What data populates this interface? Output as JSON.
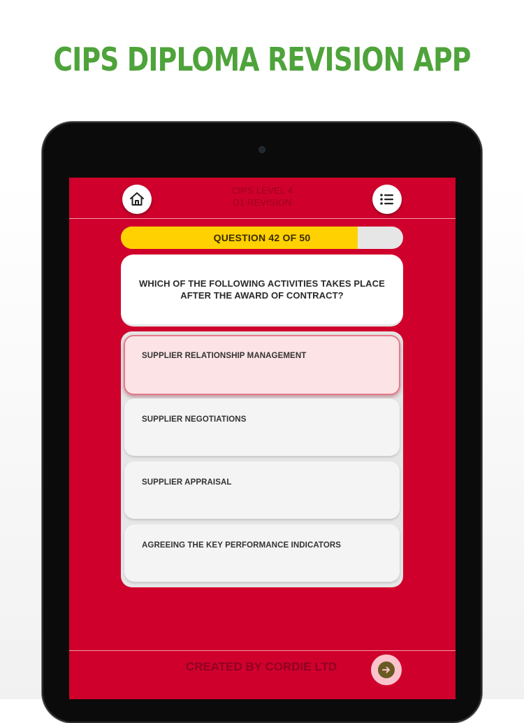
{
  "promo": {
    "title": "CIPS DIPLOMA REVISION APP"
  },
  "header": {
    "title_line1": "CIPS LEVEL 4",
    "title_line2": "D1 REVISION",
    "home_icon": "home-icon",
    "menu_icon": "list-menu-icon"
  },
  "progress": {
    "label": "QUESTION 42 OF 50",
    "current": 42,
    "total": 50,
    "fill_color": "#ffd100"
  },
  "question": {
    "text": "WHICH OF THE FOLLOWING ACTIVITIES TAKES PLACE AFTER THE AWARD OF CONTRACT?"
  },
  "answers": [
    {
      "label": "SUPPLIER RELATIONSHIP MANAGEMENT",
      "selected": true
    },
    {
      "label": "SUPPLIER NEGOTIATIONS",
      "selected": false
    },
    {
      "label": "SUPPLIER APPRAISAL",
      "selected": false
    },
    {
      "label": "AGREEING THE KEY PERFORMANCE INDICATORS",
      "selected": false
    }
  ],
  "footer": {
    "text": "CREATED BY CORDIE LTD",
    "next_icon": "arrow-right-icon"
  },
  "colors": {
    "brand_green": "#4ea33a",
    "screen_red": "#d0002c",
    "progress_yellow": "#ffd100"
  }
}
